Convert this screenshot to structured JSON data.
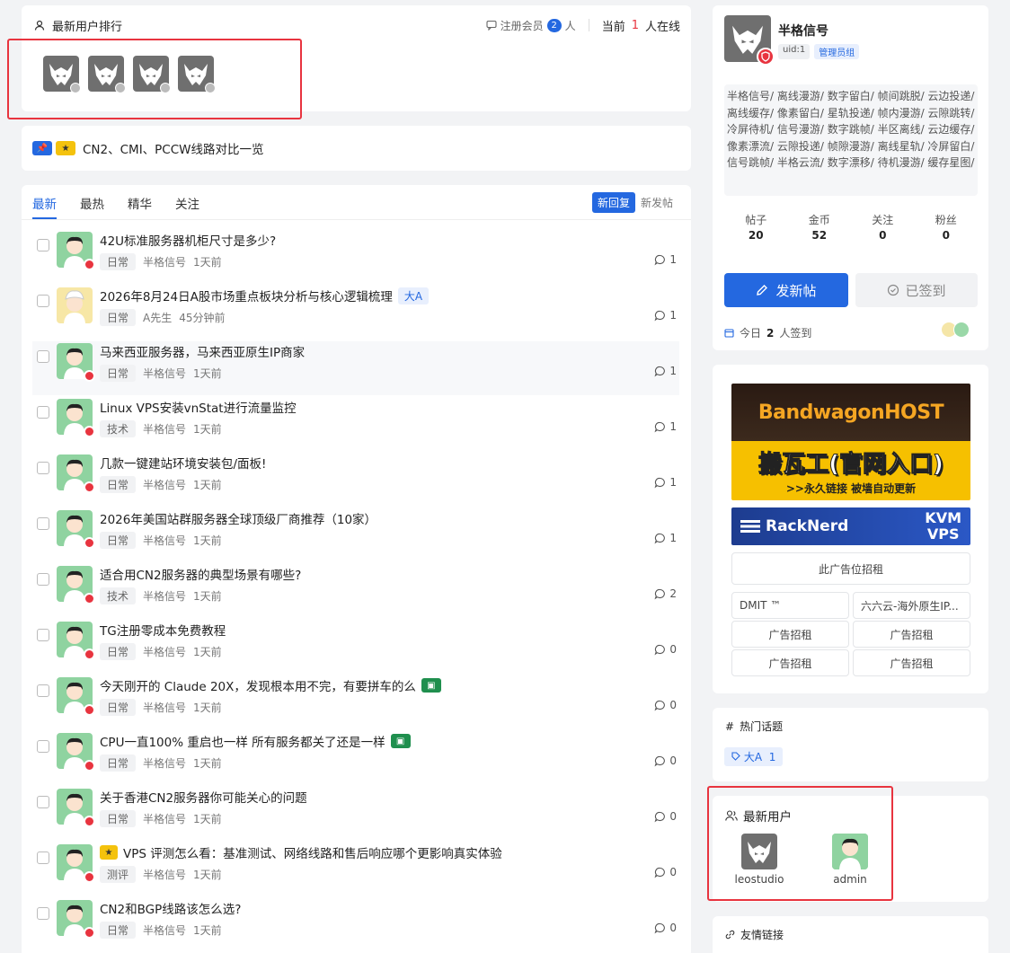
{
  "rank": {
    "title": "最新用户排行",
    "reg_label": "注册会员",
    "reg_count": "2",
    "reg_unit": "人",
    "online_prefix": "当前",
    "online_count": "1",
    "online_suffix": "人在线"
  },
  "notice": {
    "text": "CN2、CMI、PCCW线路对比一览"
  },
  "tabs": [
    "最新",
    "最热",
    "精华",
    "关注"
  ],
  "sort": {
    "active": "新回复",
    "other": "新发帖"
  },
  "topics": [
    {
      "title": "42U标准服务器机柜尺寸是多少?",
      "cat": "日常",
      "user": "半格信号",
      "time": "1天前",
      "comments": "1",
      "avatar": "admin"
    },
    {
      "title": "2026年8月24日A股市场重点板块分析与核心逻辑梳理",
      "tag": "大A",
      "cat": "日常",
      "user": "A先生",
      "time": "45分钟前",
      "comments": "1",
      "avatar": "asir"
    },
    {
      "title": "马来西亚服务器，马来西亚原生IP商家",
      "cat": "日常",
      "user": "半格信号",
      "time": "1天前",
      "comments": "1",
      "avatar": "admin",
      "highlight": true
    },
    {
      "title": "Linux VPS安装vnStat进行流量监控",
      "cat": "技术",
      "user": "半格信号",
      "time": "1天前",
      "comments": "1",
      "avatar": "admin"
    },
    {
      "title": "几款一键建站环境安装包/面板!",
      "cat": "日常",
      "user": "半格信号",
      "time": "1天前",
      "comments": "1",
      "avatar": "admin"
    },
    {
      "title": "2026年美国站群服务器全球顶级厂商推荐（10家）",
      "cat": "日常",
      "user": "半格信号",
      "time": "1天前",
      "comments": "1",
      "avatar": "admin"
    },
    {
      "title": "适合用CN2服务器的典型场景有哪些?",
      "cat": "技术",
      "user": "半格信号",
      "time": "1天前",
      "comments": "2",
      "avatar": "admin"
    },
    {
      "title": "TG注册零成本免费教程",
      "cat": "日常",
      "user": "半格信号",
      "time": "1天前",
      "comments": "0",
      "avatar": "admin"
    },
    {
      "title": "今天刚开的 Claude 20X，发现根本用不完，有要拼车的么",
      "green": true,
      "cat": "日常",
      "user": "半格信号",
      "time": "1天前",
      "comments": "0",
      "avatar": "admin"
    },
    {
      "title": "CPU一直100% 重启也一样 所有服务都关了还是一样",
      "green": true,
      "cat": "日常",
      "user": "半格信号",
      "time": "1天前",
      "comments": "0",
      "avatar": "admin"
    },
    {
      "title": "关于香港CN2服务器你可能关心的问题",
      "cat": "日常",
      "user": "半格信号",
      "time": "1天前",
      "comments": "0",
      "avatar": "admin"
    },
    {
      "title": "VPS 评测怎么看：基准测试、网络线路和售后响应哪个更影响真实体验",
      "star": true,
      "cat": "测评",
      "user": "半格信号",
      "time": "1天前",
      "comments": "0",
      "avatar": "admin"
    },
    {
      "title": "CN2和BGP线路该怎么选?",
      "cat": "日常",
      "user": "半格信号",
      "time": "1天前",
      "comments": "0",
      "avatar": "admin"
    }
  ],
  "profile": {
    "name": "半格信号",
    "uid": "uid:1",
    "role": "管理员组",
    "desc": "半格信号/ 离线漫游/ 数字留白/ 帧间跳脱/ 云边投递/ 离线缓存/ 像素留白/ 星轨投递/ 帧内漫游/ 云隙跳转/ 冷屏待机/ 信号漫游/ 数字跳帧/ 半区离线/ 云边缓存/ 像素漂流/ 云隙投递/ 帧隙漫游/ 离线星轨/ 冷屏留白/ 信号跳帧/ 半格云流/ 数字漂移/ 待机漫游/ 缓存星图/",
    "stats": [
      {
        "label": "帖子",
        "value": "20"
      },
      {
        "label": "金币",
        "value": "52"
      },
      {
        "label": "关注",
        "value": "0"
      },
      {
        "label": "粉丝",
        "value": "0"
      }
    ],
    "post_btn": "发新帖",
    "sign_btn": "已签到",
    "sign_prefix": "今日",
    "sign_count": "2",
    "sign_suffix": "人签到"
  },
  "ads": {
    "bwh_top": "BandwagonHOST",
    "bwh_main": "搬瓦工(官网入口)",
    "bwh_sub": ">>永久链接 被墙自动更新",
    "rn_name": "RackNerd",
    "rn_kvm": "KVM",
    "rn_vps": "VPS",
    "wide": "此广告位招租",
    "grid": [
      "DMIT ™",
      "六六云-海外原生IP...",
      "广告招租",
      "广告招租",
      "广告招租",
      "广告招租"
    ]
  },
  "hot": {
    "title": "热门话题",
    "tag": "大A",
    "count": "1"
  },
  "newusers": {
    "title": "最新用户",
    "users": [
      {
        "name": "leostudio",
        "avatar": "wolf"
      },
      {
        "name": "admin",
        "avatar": "admin"
      }
    ]
  },
  "links": {
    "title": "友情链接"
  },
  "colors": {
    "accent": "#2468e0",
    "danger": "#e8343f",
    "annotation": "#e8343f"
  }
}
